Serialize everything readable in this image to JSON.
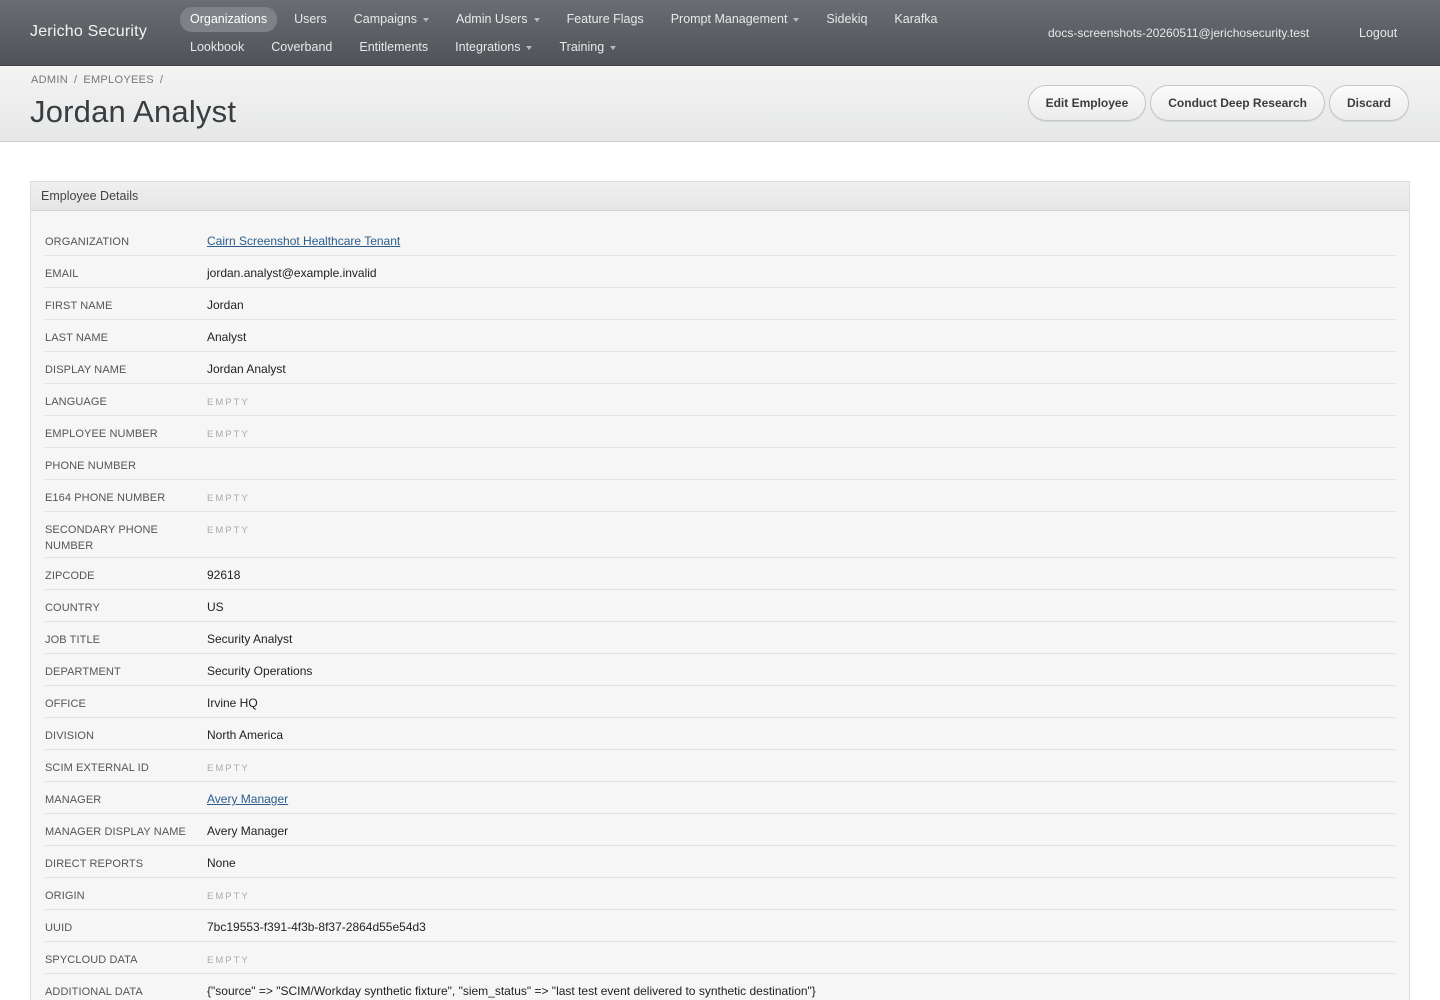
{
  "nav": {
    "brand": "Jericho Security",
    "row1": [
      {
        "label": "Organizations",
        "caret": false,
        "active": true
      },
      {
        "label": "Users",
        "caret": false
      },
      {
        "label": "Campaigns",
        "caret": true
      },
      {
        "label": "Admin Users",
        "caret": true
      },
      {
        "label": "Feature Flags",
        "caret": false
      },
      {
        "label": "Prompt Management",
        "caret": true
      },
      {
        "label": "Sidekiq",
        "caret": false
      },
      {
        "label": "Karafka",
        "caret": false
      }
    ],
    "row2": [
      {
        "label": "Lookbook",
        "caret": false
      },
      {
        "label": "Coverband",
        "caret": false
      },
      {
        "label": "Entitlements",
        "caret": false
      },
      {
        "label": "Integrations",
        "caret": true
      },
      {
        "label": "Training",
        "caret": true
      }
    ],
    "user_email": "docs-screenshots-20260511@jerichosecurity.test",
    "logout": "Logout"
  },
  "breadcrumb": {
    "admin": "ADMIN",
    "sep": "/",
    "employees": "EMPLOYEES"
  },
  "page_title": "Jordan Analyst",
  "actions": {
    "edit": "Edit Employee",
    "research": "Conduct Deep Research",
    "discard": "Discard"
  },
  "panel": {
    "heading": "Employee Details",
    "rows": [
      {
        "label": "Organization",
        "value": "Cairn Screenshot Healthcare Tenant",
        "link": true
      },
      {
        "label": "Email",
        "value": "jordan.analyst@example.invalid"
      },
      {
        "label": "First Name",
        "value": "Jordan"
      },
      {
        "label": "Last Name",
        "value": "Analyst"
      },
      {
        "label": "Display Name",
        "value": "Jordan Analyst"
      },
      {
        "label": "Language",
        "value": "EMPTY",
        "empty": true
      },
      {
        "label": "Employee Number",
        "value": "EMPTY",
        "empty": true
      },
      {
        "label": "Phone Number",
        "value": ""
      },
      {
        "label": "E164 Phone Number",
        "value": "EMPTY",
        "empty": true
      },
      {
        "label": "Secondary Phone Number",
        "value": "EMPTY",
        "empty": true,
        "tall": true
      },
      {
        "label": "Zipcode",
        "value": "92618"
      },
      {
        "label": "Country",
        "value": "US"
      },
      {
        "label": "Job Title",
        "value": "Security Analyst"
      },
      {
        "label": "Department",
        "value": "Security Operations"
      },
      {
        "label": "Office",
        "value": "Irvine HQ"
      },
      {
        "label": "Division",
        "value": "North America"
      },
      {
        "label": "SCIM External ID",
        "value": "EMPTY",
        "empty": true
      },
      {
        "label": "Manager",
        "value": "Avery Manager",
        "link": true
      },
      {
        "label": "Manager Display Name",
        "value": "Avery Manager"
      },
      {
        "label": "Direct Reports",
        "value": "None"
      },
      {
        "label": "Origin",
        "value": "EMPTY",
        "empty": true
      },
      {
        "label": "UUID",
        "value": "7bc19553-f391-4f3b-8f37-2864d55e54d3"
      },
      {
        "label": "Spycloud Data",
        "value": "EMPTY",
        "empty": true
      },
      {
        "label": "Additional Data",
        "value": "{\"source\" => \"SCIM/Workday synthetic fixture\", \"siem_status\" => \"last test event delivered to synthetic destination\"}"
      }
    ]
  }
}
